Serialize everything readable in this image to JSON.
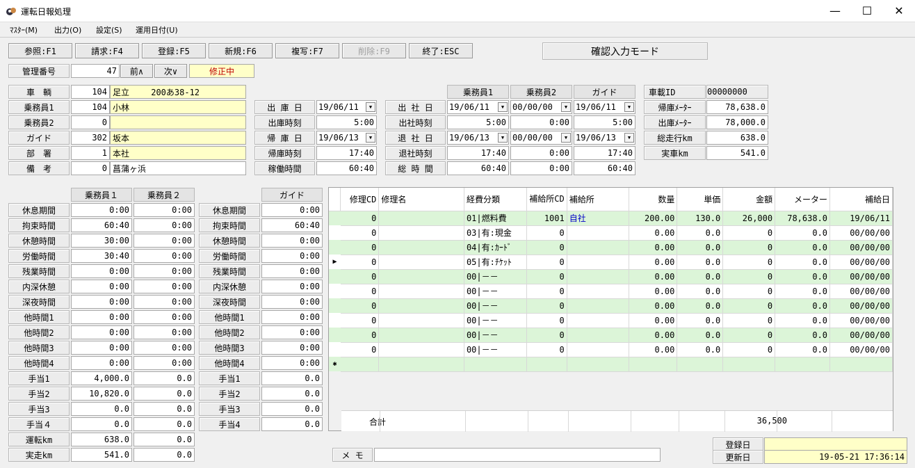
{
  "window": {
    "title": "運転日報処理",
    "min": "—",
    "max": "☐",
    "close": "✕"
  },
  "menu": [
    "ﾏｽﾀｰ(M)",
    "出力(O)",
    "設定(S)",
    "運用日付(U)"
  ],
  "toolbar": [
    {
      "label": "参照:F1"
    },
    {
      "label": "請求:F4"
    },
    {
      "label": "登録:F5"
    },
    {
      "label": "新規:F6"
    },
    {
      "label": "複写:F7"
    },
    {
      "label": "削除:F9",
      "disabled": true
    },
    {
      "label": "終了:ESC"
    }
  ],
  "mode_label": "確認入力モード",
  "kanri": {
    "label": "管理番号",
    "value": "47",
    "prev": "前∧",
    "next": "次∨",
    "status": "修正中"
  },
  "info": [
    {
      "label": "車　輌",
      "code": "104",
      "name": "足立　　 200あ38-12"
    },
    {
      "label": "乗務員1",
      "code": "104",
      "name": "小林"
    },
    {
      "label": "乗務員2",
      "code": "0",
      "name": ""
    },
    {
      "label": "ガイド",
      "code": "302",
      "name": "坂本"
    },
    {
      "label": "部　署",
      "code": "1",
      "name": "本社"
    },
    {
      "label": "備　考",
      "code": "0",
      "name": "菖蒲ヶ浜"
    }
  ],
  "depot": {
    "rows": [
      {
        "label": "出 庫 日",
        "value": "19/06/11",
        "combo": true
      },
      {
        "label": "出庫時刻",
        "value": "5:00"
      },
      {
        "label": "帰 庫 日",
        "value": "19/06/13",
        "combo": true
      },
      {
        "label": "帰庫時刻",
        "value": "17:40"
      },
      {
        "label": "稼働時間",
        "value": "60:40"
      }
    ]
  },
  "office": {
    "headers": [
      "乗務員1",
      "乗務員2",
      "ガイド"
    ],
    "rows": [
      {
        "label": "出 社 日",
        "values": [
          "19/06/11",
          "00/00/00",
          "19/06/11"
        ],
        "combo": true
      },
      {
        "label": "出社時刻",
        "values": [
          "5:00",
          "0:00",
          "5:00"
        ]
      },
      {
        "label": "退 社 日",
        "values": [
          "19/06/13",
          "00/00/00",
          "19/06/13"
        ],
        "combo": true
      },
      {
        "label": "退社時刻",
        "values": [
          "17:40",
          "0:00",
          "17:40"
        ]
      },
      {
        "label": "総 時 間",
        "values": [
          "60:40",
          "0:00",
          "60:40"
        ]
      }
    ]
  },
  "vehicle": {
    "id_label": "車載ID",
    "id_value": "00000000",
    "rows": [
      {
        "label": "帰庫ﾒｰﾀｰ",
        "value": "78,638.0"
      },
      {
        "label": "出庫ﾒｰﾀｰ",
        "value": "78,000.0"
      },
      {
        "label": "総走行km",
        "value": "638.0"
      },
      {
        "label": "実車km",
        "value": "541.0"
      }
    ]
  },
  "crew": {
    "headers": [
      "乗務員１",
      "乗務員２"
    ],
    "rows": [
      {
        "label": "休息期間",
        "v1": "0:00",
        "v2": "0:00"
      },
      {
        "label": "拘束時間",
        "v1": "60:40",
        "v2": "0:00"
      },
      {
        "label": "休憩時間",
        "v1": "30:00",
        "v2": "0:00"
      },
      {
        "label": "労働時間",
        "v1": "30:40",
        "v2": "0:00"
      },
      {
        "label": "残業時間",
        "v1": "0:00",
        "v2": "0:00"
      },
      {
        "label": "内深休憩",
        "v1": "0:00",
        "v2": "0:00"
      },
      {
        "label": "深夜時間",
        "v1": "0:00",
        "v2": "0:00"
      },
      {
        "label": "他時間1",
        "v1": "0:00",
        "v2": "0:00"
      },
      {
        "label": "他時間2",
        "v1": "0:00",
        "v2": "0:00"
      },
      {
        "label": "他時間3",
        "v1": "0:00",
        "v2": "0:00"
      },
      {
        "label": "他時間4",
        "v1": "0:00",
        "v2": "0:00"
      },
      {
        "label": "手当1",
        "v1": "4,000.0",
        "v2": "0.0"
      },
      {
        "label": "手当2",
        "v1": "10,820.0",
        "v2": "0.0"
      },
      {
        "label": "手当3",
        "v1": "0.0",
        "v2": "0.0"
      },
      {
        "label": "手当４",
        "v1": "0.0",
        "v2": "0.0"
      },
      {
        "label": "運転km",
        "v1": "638.0",
        "v2": "0.0"
      },
      {
        "label": "実走km",
        "v1": "541.0",
        "v2": "0.0"
      }
    ]
  },
  "guide": {
    "header": "ガイド",
    "rows": [
      {
        "label": "休息期間",
        "v": "0:00"
      },
      {
        "label": "拘束時間",
        "v": "60:40"
      },
      {
        "label": "休憩時間",
        "v": "0:00"
      },
      {
        "label": "労働時間",
        "v": "0:00"
      },
      {
        "label": "残業時間",
        "v": "0:00"
      },
      {
        "label": "内深休憩",
        "v": "0:00"
      },
      {
        "label": "深夜時間",
        "v": "0:00"
      },
      {
        "label": "他時間1",
        "v": "0:00"
      },
      {
        "label": "他時間2",
        "v": "0:00"
      },
      {
        "label": "他時間3",
        "v": "0:00"
      },
      {
        "label": "他時間4",
        "v": "0:00"
      },
      {
        "label": "手当1",
        "v": "0.0"
      },
      {
        "label": "手当2",
        "v": "0.0"
      },
      {
        "label": "手当3",
        "v": "0.0"
      },
      {
        "label": "手当4",
        "v": "0.0"
      }
    ]
  },
  "grid": {
    "headers": [
      "修理CD",
      "修理名",
      "経費分類",
      "補給所CD",
      "補給所",
      "数量",
      "単価",
      "金額",
      "メーター",
      "補給日"
    ],
    "rows": [
      [
        "0",
        "",
        "01|燃料費",
        "1001",
        "自社",
        "200.00",
        "130.0",
        "26,000",
        "78,638.0",
        "19/06/11"
      ],
      [
        "0",
        "",
        "03|有:現金",
        "0",
        "",
        "0.00",
        "0.0",
        "0",
        "0.0",
        "00/00/00"
      ],
      [
        "0",
        "",
        "04|有:ｶｰﾄﾞ",
        "0",
        "",
        "0.00",
        "0.0",
        "0",
        "0.0",
        "00/00/00"
      ],
      [
        "0",
        "",
        "05|有:ﾁｹｯﾄ",
        "0",
        "",
        "0.00",
        "0.0",
        "0",
        "0.0",
        "00/00/00"
      ],
      [
        "0",
        "",
        "00|－－",
        "0",
        "",
        "0.00",
        "0.0",
        "0",
        "0.0",
        "00/00/00"
      ],
      [
        "0",
        "",
        "00|－－",
        "0",
        "",
        "0.00",
        "0.0",
        "0",
        "0.0",
        "00/00/00"
      ],
      [
        "0",
        "",
        "00|－－",
        "0",
        "",
        "0.00",
        "0.0",
        "0",
        "0.0",
        "00/00/00"
      ],
      [
        "0",
        "",
        "00|－－",
        "0",
        "",
        "0.00",
        "0.0",
        "0",
        "0.0",
        "00/00/00"
      ],
      [
        "0",
        "",
        "00|－－",
        "0",
        "",
        "0.00",
        "0.0",
        "0",
        "0.0",
        "00/00/00"
      ],
      [
        "0",
        "",
        "00|－－",
        "0",
        "",
        "0.00",
        "0.0",
        "0",
        "0.0",
        "00/00/00"
      ]
    ],
    "current_marker": "▶",
    "new_marker": "✱",
    "total_label": "合計",
    "total_value": "36,500"
  },
  "memo": {
    "label": "メ モ",
    "value": ""
  },
  "registered": {
    "label": "登録日",
    "value": ""
  },
  "updated": {
    "label": "更新日",
    "value": "19-05-21 17:36:14"
  }
}
